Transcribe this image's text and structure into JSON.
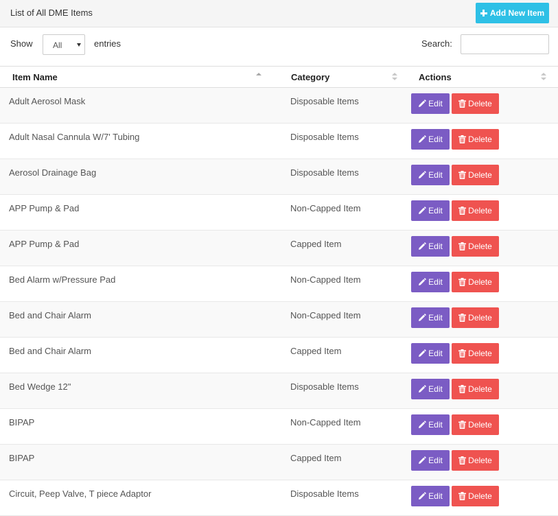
{
  "panel": {
    "title": "List of All DME Items",
    "add_button_label": "Add New Item"
  },
  "controls": {
    "show_label": "Show",
    "entries_selected": "All",
    "entries_label": "entries",
    "search_label": "Search:",
    "search_value": ""
  },
  "table": {
    "columns": [
      "Item Name",
      "Category",
      "Actions"
    ],
    "edit_label": "Edit",
    "delete_label": "Delete",
    "rows": [
      {
        "name": "Adult Aerosol Mask",
        "category": "Disposable Items"
      },
      {
        "name": "Adult Nasal Cannula W/7' Tubing",
        "category": "Disposable Items"
      },
      {
        "name": "Aerosol Drainage Bag",
        "category": "Disposable Items"
      },
      {
        "name": "APP Pump & Pad",
        "category": "Non-Capped Item"
      },
      {
        "name": "APP Pump & Pad",
        "category": "Capped Item"
      },
      {
        "name": "Bed Alarm w/Pressure Pad",
        "category": "Non-Capped Item"
      },
      {
        "name": "Bed and Chair Alarm",
        "category": "Non-Capped Item"
      },
      {
        "name": "Bed and Chair Alarm",
        "category": "Capped Item"
      },
      {
        "name": "Bed Wedge 12\"",
        "category": "Disposable Items"
      },
      {
        "name": "BIPAP",
        "category": "Non-Capped Item"
      },
      {
        "name": "BIPAP",
        "category": "Capped Item"
      },
      {
        "name": "Circuit, Peep Valve, T piece Adaptor",
        "category": "Disposable Items"
      }
    ]
  },
  "colors": {
    "add": "#2ec0e6",
    "edit": "#7b5cc4",
    "delete": "#ef5350"
  },
  "icons": {
    "add": "plus-icon",
    "edit": "pencil-icon",
    "delete": "trash-icon",
    "sort": "sort-icon",
    "select": "caret-down-icon"
  }
}
